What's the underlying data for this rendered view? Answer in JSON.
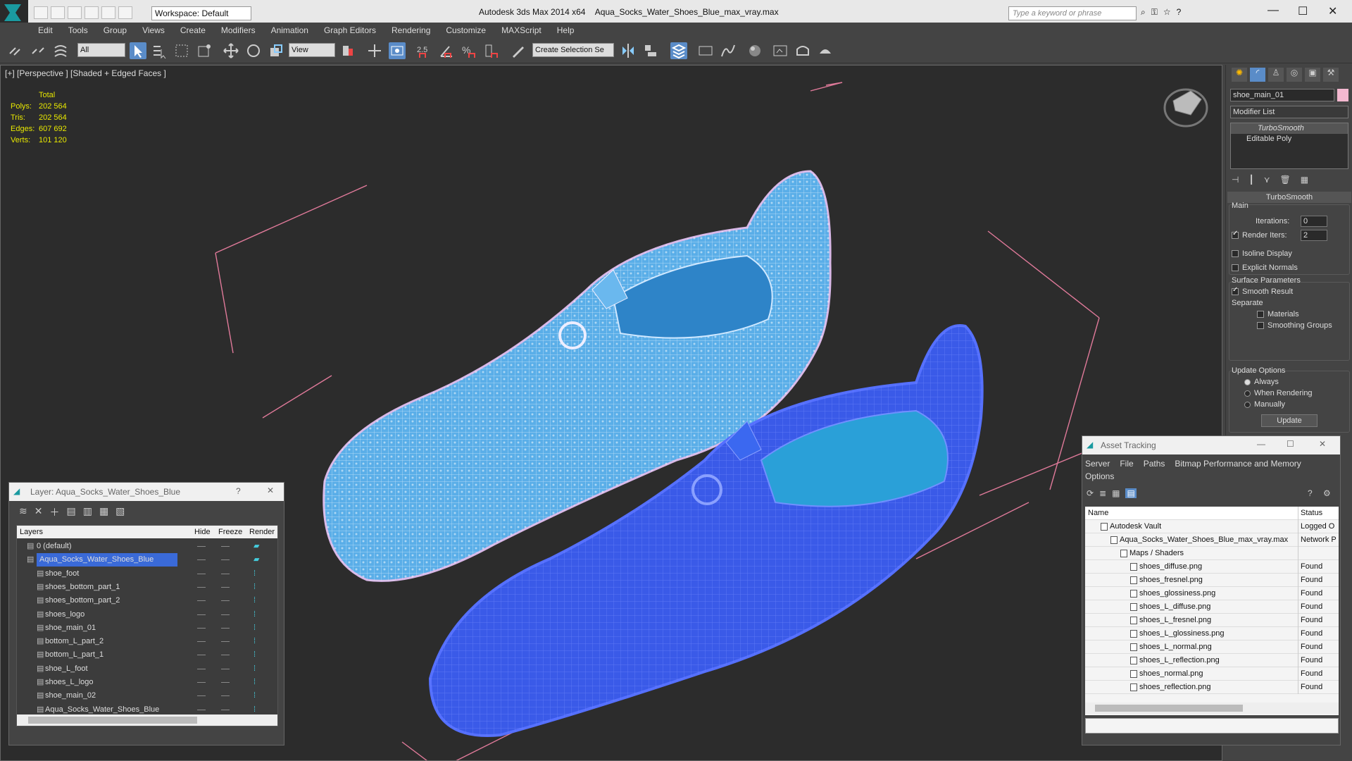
{
  "app": {
    "title": "Autodesk 3ds Max  2014 x64",
    "file": "Aqua_Socks_Water_Shoes_Blue_max_vray.max",
    "workspace": "Workspace: Default",
    "search_placeholder": "Type a keyword or phrase"
  },
  "menu": [
    "Edit",
    "Tools",
    "Group",
    "Views",
    "Create",
    "Modifiers",
    "Animation",
    "Graph Editors",
    "Rendering",
    "Customize",
    "MAXScript",
    "Help"
  ],
  "toolbar": {
    "filter": "All",
    "ref_coord": "View",
    "selection_set": "Create Selection Se"
  },
  "viewport": {
    "label": "[+] [Perspective ] [Shaded + Edged Faces ]",
    "stats": {
      "header": "Total",
      "rows": [
        {
          "label": "Polys:",
          "value": "202 564"
        },
        {
          "label": "Tris:",
          "value": "202 564"
        },
        {
          "label": "Edges:",
          "value": "607 692"
        },
        {
          "label": "Verts:",
          "value": "101 120"
        }
      ]
    },
    "colors": {
      "shoe1": "#4aa0e0",
      "shoe2": "#3a50e8",
      "frame": "#e07a9a",
      "bg": "#2c2c2c"
    }
  },
  "command_panel": {
    "object_name": "shoe_main_01",
    "modifier_list": "Modifier List",
    "stack": [
      "TurboSmooth",
      "Editable Poly"
    ],
    "rollout_title": "TurboSmooth",
    "main_label": "Main",
    "iterations_label": "Iterations:",
    "iterations": "0",
    "render_iters_label": "Render Iters:",
    "render_iters": "2",
    "isoline": "Isoline Display",
    "explicit_normals": "Explicit Normals",
    "surface_params": "Surface Parameters",
    "smooth_result": "Smooth Result",
    "separate": "Separate",
    "materials": "Materials",
    "smoothing_groups": "Smoothing Groups",
    "update_options": "Update Options",
    "always": "Always",
    "when_rendering": "When Rendering",
    "manually": "Manually",
    "update_button": "Update"
  },
  "layer_window": {
    "title": "Layer: Aqua_Socks_Water_Shoes_Blue",
    "columns": [
      "Layers",
      "Hide",
      "Freeze",
      "Render"
    ],
    "rows": [
      {
        "name": "0 (default)",
        "level": 0
      },
      {
        "name": "Aqua_Socks_Water_Shoes_Blue",
        "level": 0,
        "selected": true
      },
      {
        "name": "shoe_foot",
        "level": 1
      },
      {
        "name": "shoes_bottom_part_1",
        "level": 1
      },
      {
        "name": "shoes_bottom_part_2",
        "level": 1
      },
      {
        "name": "shoes_logo",
        "level": 1
      },
      {
        "name": "shoe_main_01",
        "level": 1
      },
      {
        "name": "bottom_L_part_2",
        "level": 1
      },
      {
        "name": "bottom_L_part_1",
        "level": 1
      },
      {
        "name": "shoe_L_foot",
        "level": 1
      },
      {
        "name": "shoes_L_logo",
        "level": 1
      },
      {
        "name": "shoe_main_02",
        "level": 1
      },
      {
        "name": "Aqua_Socks_Water_Shoes_Blue",
        "level": 1
      }
    ]
  },
  "asset_window": {
    "title": "Asset Tracking",
    "menu": [
      "Server",
      "File",
      "Paths",
      "Bitmap Performance and Memory",
      "Options"
    ],
    "columns": [
      "Name",
      "Status"
    ],
    "rows": [
      {
        "name": "Autodesk Vault",
        "status": "Logged O",
        "level": 1
      },
      {
        "name": "Aqua_Socks_Water_Shoes_Blue_max_vray.max",
        "status": "Network P",
        "level": 2
      },
      {
        "name": "Maps / Shaders",
        "status": "",
        "level": 3
      },
      {
        "name": "shoes_diffuse.png",
        "status": "Found",
        "level": 4
      },
      {
        "name": "shoes_fresnel.png",
        "status": "Found",
        "level": 4
      },
      {
        "name": "shoes_glossiness.png",
        "status": "Found",
        "level": 4
      },
      {
        "name": "shoes_L_diffuse.png",
        "status": "Found",
        "level": 4
      },
      {
        "name": "shoes_L_fresnel.png",
        "status": "Found",
        "level": 4
      },
      {
        "name": "shoes_L_glossiness.png",
        "status": "Found",
        "level": 4
      },
      {
        "name": "shoes_L_normal.png",
        "status": "Found",
        "level": 4
      },
      {
        "name": "shoes_L_reflection.png",
        "status": "Found",
        "level": 4
      },
      {
        "name": "shoes_normal.png",
        "status": "Found",
        "level": 4
      },
      {
        "name": "shoes_reflection.png",
        "status": "Found",
        "level": 4
      }
    ]
  }
}
